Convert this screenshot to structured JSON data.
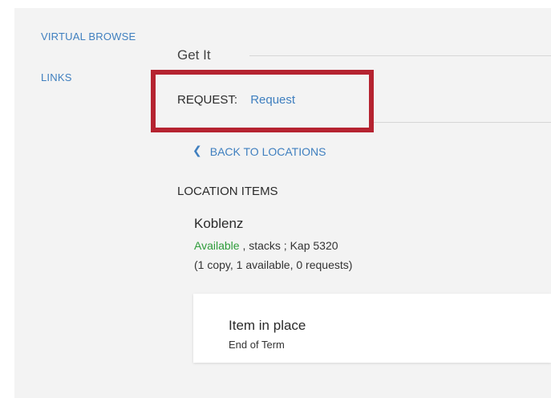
{
  "sidebar": {
    "items": [
      {
        "label": "VIRTUAL BROWSE"
      },
      {
        "label": "LINKS"
      }
    ]
  },
  "get_it": {
    "title": "Get It",
    "request_label": "REQUEST:",
    "request_link": "Request"
  },
  "back_link": {
    "icon": "chevron-left-icon",
    "label": "BACK TO LOCATIONS"
  },
  "location_items": {
    "heading": "LOCATION ITEMS",
    "location": {
      "name": "Koblenz",
      "availability": "Available",
      "shelf": " , stacks ; Kap 5320",
      "counts": "(1 copy, 1 available, 0 requests)"
    },
    "item": {
      "status": "Item in place",
      "policy": "End of Term"
    }
  },
  "colors": {
    "link": "#3f7fbf",
    "available": "#2e9c3a",
    "highlight_border": "#b52330",
    "page_background": "#f3f3f3"
  }
}
